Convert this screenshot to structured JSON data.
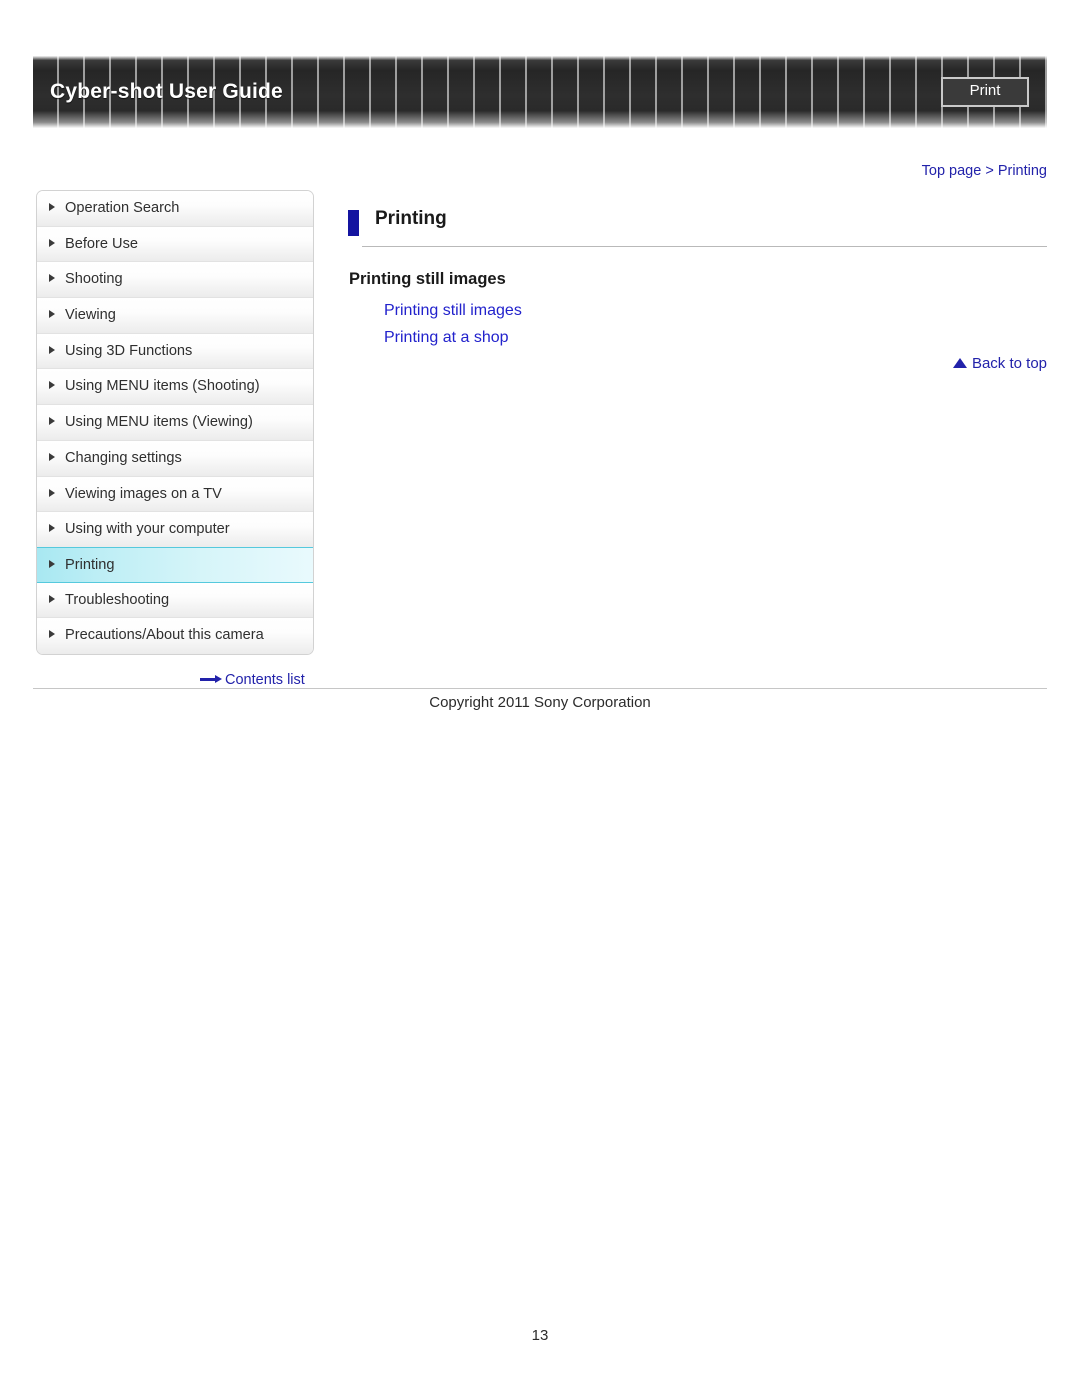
{
  "header": {
    "title": "Cyber-shot User Guide",
    "print_label": "Print"
  },
  "breadcrumb": {
    "text": "Top page > Printing"
  },
  "sidebar": {
    "items": [
      {
        "label": "Operation Search",
        "active": false
      },
      {
        "label": "Before Use",
        "active": false
      },
      {
        "label": "Shooting",
        "active": false
      },
      {
        "label": "Viewing",
        "active": false
      },
      {
        "label": "Using 3D Functions",
        "active": false
      },
      {
        "label": "Using MENU items (Shooting)",
        "active": false
      },
      {
        "label": "Using MENU items (Viewing)",
        "active": false
      },
      {
        "label": "Changing settings",
        "active": false
      },
      {
        "label": "Viewing images on a TV",
        "active": false
      },
      {
        "label": "Using with your computer",
        "active": false
      },
      {
        "label": "Printing",
        "active": true
      },
      {
        "label": "Troubleshooting",
        "active": false
      },
      {
        "label": "Precautions/About this camera",
        "active": false
      }
    ],
    "contents_link": "Contents list"
  },
  "main": {
    "page_title": "Printing",
    "section_heading": "Printing still images",
    "links": [
      "Printing still images",
      "Printing at a shop"
    ],
    "back_to_top": "Back to top"
  },
  "footer": {
    "copyright": "Copyright 2011 Sony Corporation",
    "page_number": "13"
  },
  "colors": {
    "link_blue": "#2222cc",
    "breadcrumb_blue": "#2222aa",
    "title_bar_blue": "#1414a0",
    "active_nav_cyan": "#a8e8f2",
    "banner_dark": "#262626"
  }
}
